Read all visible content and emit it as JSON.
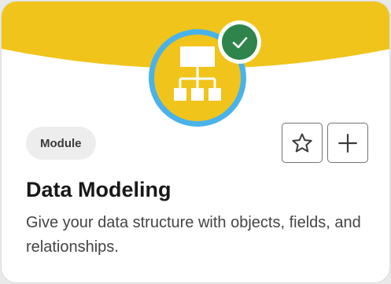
{
  "card": {
    "type_label": "Module",
    "title": "Data Modeling",
    "description": "Give your data structure with objects, fields, and relationships.",
    "completed": true,
    "actions": {
      "favorite_icon": "star-outline-icon",
      "add_icon": "plus-icon"
    },
    "badge_icon": "hierarchy-icon"
  },
  "colors": {
    "banner": "#f0c41b",
    "badge_ring": "#4ab2ea",
    "complete": "#2e844a"
  }
}
